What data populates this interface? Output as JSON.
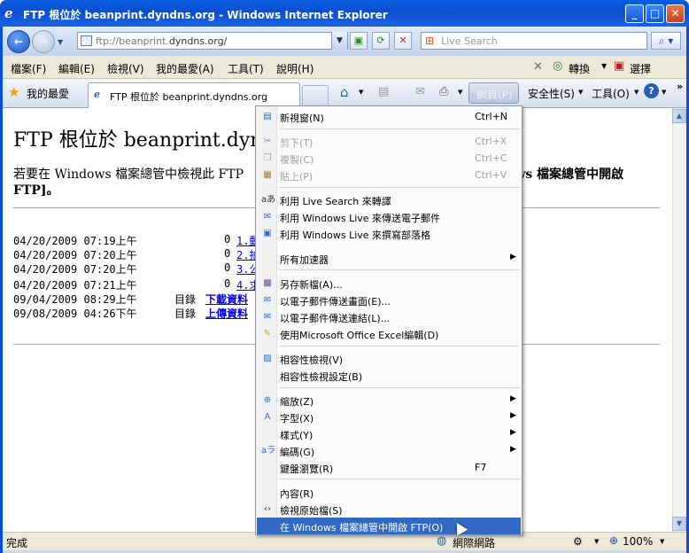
{
  "window": {
    "title": "FTP 根位於 beanprint.dyndns.org - Windows Internet Explorer"
  },
  "address": {
    "prefix": "ftp://beanprint.",
    "host": "dyndns.org/",
    "search_placeholder": "Live Search"
  },
  "menubar": {
    "items": [
      "檔案(F)",
      "編輯(E)",
      "檢視(V)",
      "我的最愛(A)",
      "工具(T)",
      "說明(H)"
    ],
    "translate_label": "轉換",
    "select_label": "選擇"
  },
  "tabbar": {
    "favorites_label": "我的最愛",
    "tab_title": "FTP 根位於 beanprint.dyndns.org",
    "page_label": "網頁(P)",
    "safety_label": "安全性(S)",
    "tools_label": "工具(O)"
  },
  "page": {
    "heading": "FTP 根位於 beanprint.dynd",
    "intro_start": "若要在 Windows 檔案總管中檢視此 FTP",
    "intro_end": "ows 檔案總管中開啟",
    "intro_line2": "FTP]。",
    "listing": [
      {
        "date": "04/20/2009 07:19上午",
        "size": "0",
        "name": "1.動"
      },
      {
        "date": "04/20/2009 07:20上午",
        "size": "0",
        "name": "2.拍"
      },
      {
        "date": "04/20/2009 07:20上午",
        "size": "0",
        "name": "3.公"
      },
      {
        "date": "04/20/2009 07:21上午",
        "size": "0",
        "name": "4.求"
      },
      {
        "date": "09/04/2009 08:29上午",
        "size": "目錄",
        "name": "下載資料"
      },
      {
        "date": "09/08/2009 04:26下午",
        "size": "目錄",
        "name": "上傳資料"
      }
    ]
  },
  "context_menu": {
    "items": [
      {
        "label": "新視窗(N)",
        "shortcut": "Ctrl+N",
        "icon": "new-window-icon"
      },
      {
        "label": "剪下(T)",
        "shortcut": "Ctrl+X",
        "icon": "cut-icon",
        "disabled": true
      },
      {
        "label": "複製(C)",
        "shortcut": "Ctrl+C",
        "icon": "copy-icon",
        "disabled": true
      },
      {
        "label": "貼上(P)",
        "shortcut": "Ctrl+V",
        "icon": "paste-icon",
        "disabled": true
      },
      {
        "label": "利用 Live Search 來轉譯",
        "icon": "translate-icon"
      },
      {
        "label": "利用 Windows Live 來傳送電子郵件",
        "icon": "email-live-icon"
      },
      {
        "label": "利用 Windows Live 來撰寫部落格",
        "icon": "blog-icon"
      },
      {
        "label": "所有加速器",
        "submenu": true
      },
      {
        "label": "另存新檔(A)...",
        "icon": "save-as-icon"
      },
      {
        "label": "以電子郵件傳送畫面(E)...",
        "icon": "email-page-icon"
      },
      {
        "label": "以電子郵件傳送連結(L)...",
        "icon": "email-link-icon"
      },
      {
        "label": "使用Microsoft Office Excel編輯(D)",
        "icon": "edit-pencil-icon"
      },
      {
        "label": "相容性檢視(V)",
        "icon": "compat-view-icon"
      },
      {
        "label": "相容性檢視設定(B)"
      },
      {
        "label": "縮放(Z)",
        "icon": "zoom-icon",
        "submenu": true
      },
      {
        "label": "字型(X)",
        "icon": "text-size-icon",
        "submenu": true
      },
      {
        "label": "樣式(Y)",
        "submenu": true
      },
      {
        "label": "編碼(G)",
        "icon": "encoding-icon",
        "submenu": true
      },
      {
        "label": "鍵盤瀏覽(R)",
        "shortcut": "F7"
      },
      {
        "label": "內容(R)"
      },
      {
        "label": "檢視原始檔(S)",
        "icon": "view-source-icon"
      },
      {
        "label": "在 Windows 檔案總管中開啟 FTP(O)",
        "selected": true
      }
    ]
  },
  "statusbar": {
    "status": "完成",
    "zone": "網際網路",
    "zoom": "100%"
  }
}
